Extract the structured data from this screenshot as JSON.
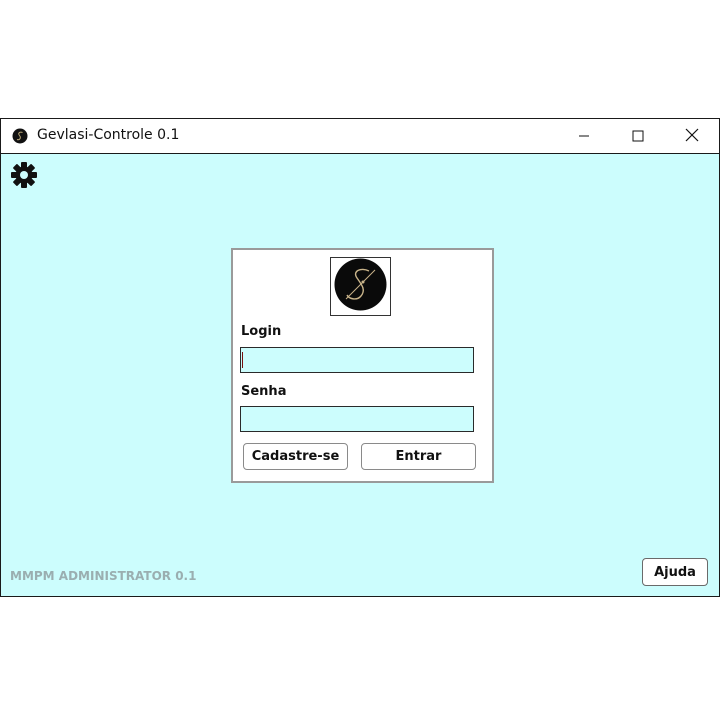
{
  "window": {
    "title": "Gevlasi-Controle 0.1"
  },
  "icons": {
    "app": "app-logo-icon",
    "settings": "gear-icon",
    "minimize": "minimize-icon",
    "maximize": "maximize-icon",
    "close": "close-icon",
    "logo": "s-logo-icon"
  },
  "login": {
    "login_label": "Login",
    "login_value": "",
    "senha_label": "Senha",
    "senha_value": "",
    "register_button": "Cadastre-se",
    "submit_button": "Entrar"
  },
  "footer": {
    "version_text": "MMPM ADMINISTRATOR 0.1",
    "help_button": "Ajuda"
  },
  "colors": {
    "client_background": "#ccfdfd",
    "input_background": "#ccfdfd",
    "footer_text": "#9aaeb0"
  }
}
